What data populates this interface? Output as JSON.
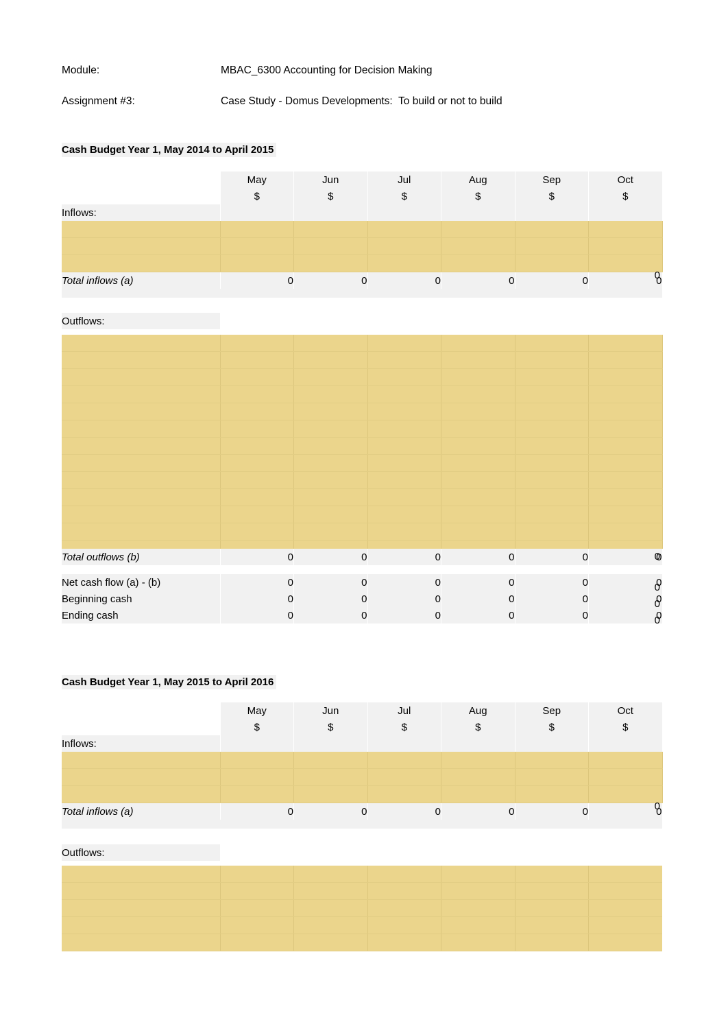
{
  "document": {
    "heading_rows": [
      {
        "label": "Module:",
        "value": "MBAC_6300 Accounting for Decision Making"
      },
      {
        "label": "Assignment #3:",
        "value": "Case Study - Domus Developments:  To build or not to build"
      }
    ]
  },
  "colors": {
    "entry_block": "#ebd58c",
    "cell_background": "#f1f1f1",
    "page_background": "#ffffff",
    "text": "#000000"
  },
  "months": [
    {
      "name": "May",
      "currency": "$"
    },
    {
      "name": "Jun",
      "currency": "$"
    },
    {
      "name": "Jul",
      "currency": "$"
    },
    {
      "name": "Aug",
      "currency": "$"
    },
    {
      "name": "Sep",
      "currency": "$"
    },
    {
      "name": "Oct",
      "currency": "$"
    }
  ],
  "labels": {
    "inflows_heading": "Inflows:",
    "outflows_heading": "Outflows:",
    "total_inflows": "Total inflows (a)",
    "total_outflows": "Total outflows (b)",
    "net_cash_flow": "Net cash flow (a) - (b)",
    "beginning_cash": "Beginning cash",
    "ending_cash": "Ending  cash"
  },
  "section_one": {
    "title": "Cash Budget Year 1, May 2014 to April 2015",
    "inflow_entry_rows": 3,
    "outflow_entry_rows": 13,
    "total_inflows": [
      "0",
      "0",
      "0",
      "0",
      "0",
      "0",
      "0"
    ],
    "total_outflows": [
      "0",
      "0",
      "0",
      "0",
      "0",
      "0",
      "0"
    ],
    "net_cash_flow": [
      "0",
      "0",
      "0",
      "0",
      "0",
      "0",
      "0"
    ],
    "beginning_cash": [
      "0",
      "0",
      "0",
      "0",
      "0",
      "0",
      "0"
    ],
    "ending_cash": [
      "0",
      "0",
      "0",
      "0",
      "0",
      "0",
      "0"
    ]
  },
  "section_two": {
    "title": "Cash Budget Year 1, May 2015 to April 2016",
    "inflow_entry_rows": 3,
    "outflow_entry_rows": 5,
    "total_inflows": [
      "0",
      "0",
      "0",
      "0",
      "0",
      "0",
      "0"
    ]
  }
}
